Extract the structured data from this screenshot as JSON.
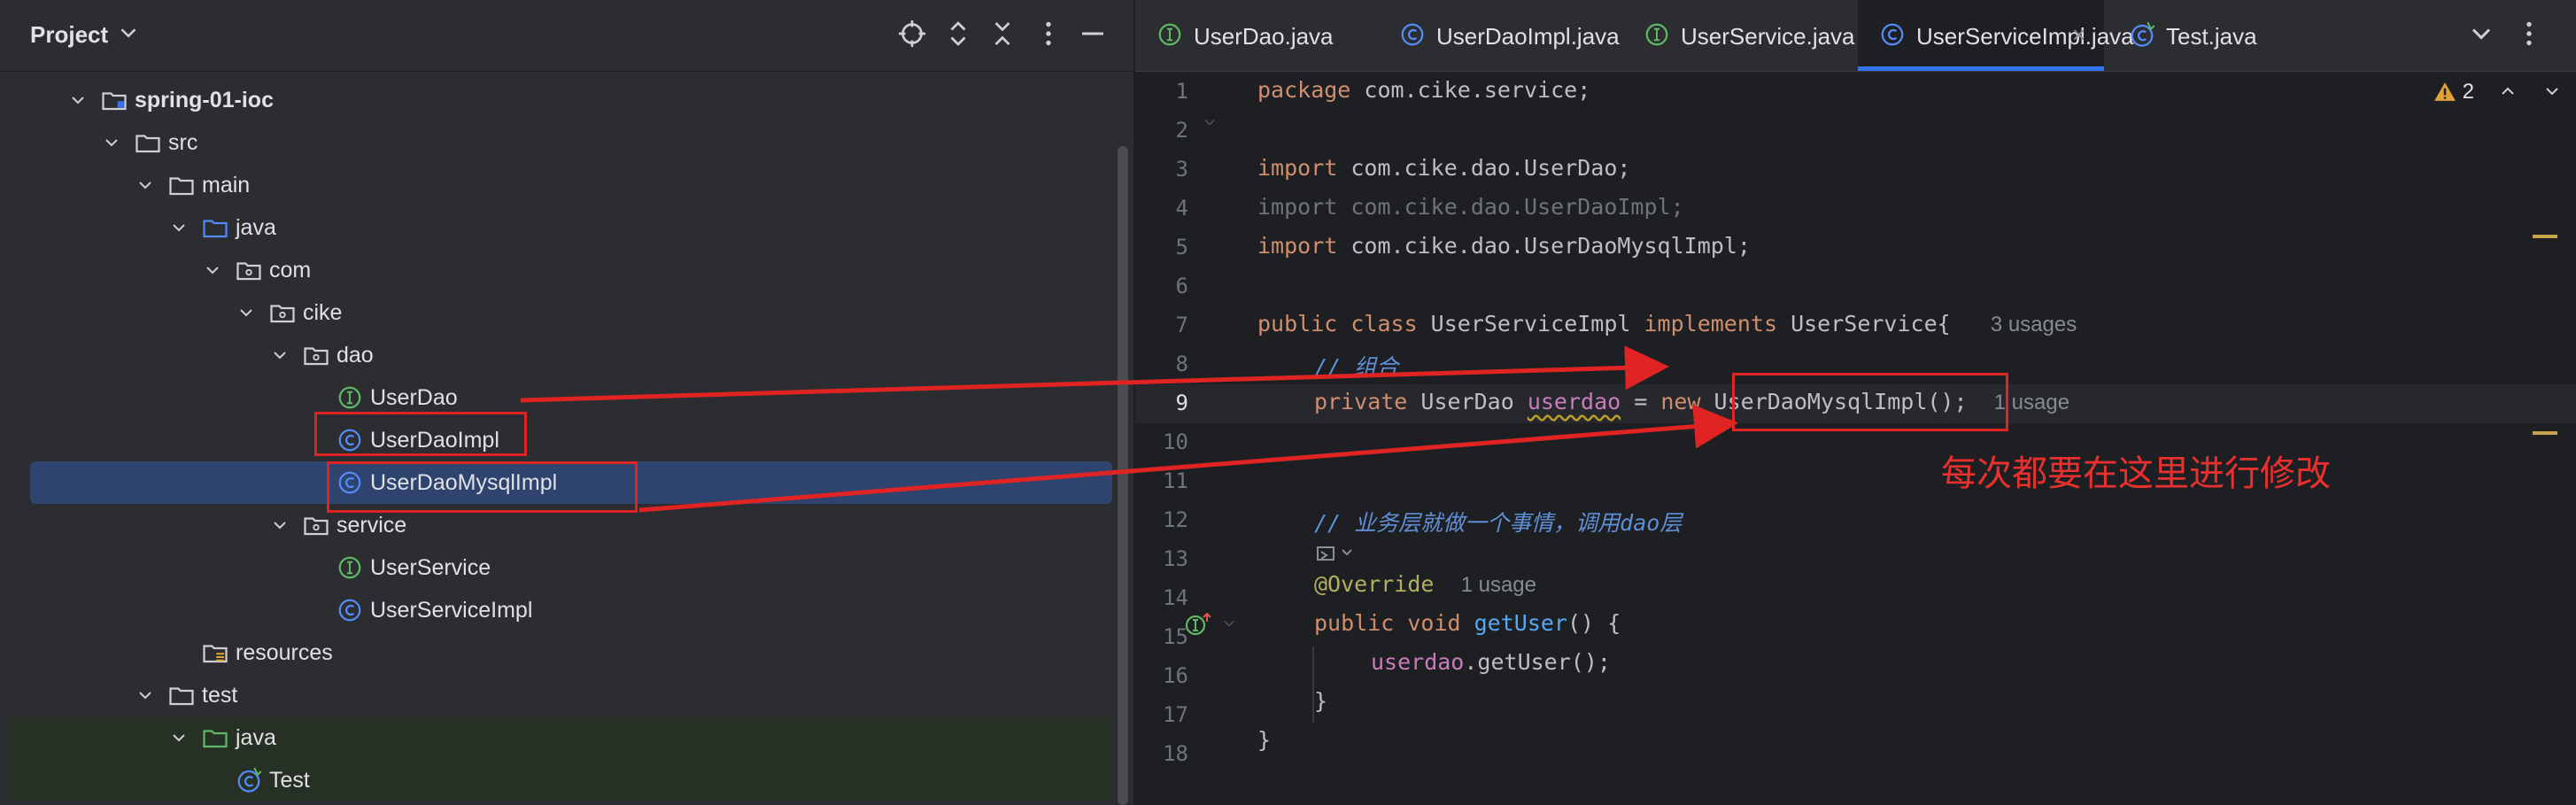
{
  "project_panel": {
    "title": "Project",
    "tree": [
      {
        "label": "spring-01-ioc",
        "icon": "module-folder-icon",
        "depth": 0,
        "expanded": true,
        "bold": true
      },
      {
        "label": "src",
        "icon": "folder-icon",
        "depth": 1,
        "expanded": true
      },
      {
        "label": "main",
        "icon": "folder-icon",
        "depth": 2,
        "expanded": true
      },
      {
        "label": "java",
        "icon": "source-folder-icon",
        "depth": 3,
        "expanded": true
      },
      {
        "label": "com",
        "icon": "package-icon",
        "depth": 4,
        "expanded": true
      },
      {
        "label": "cike",
        "icon": "package-icon",
        "depth": 5,
        "expanded": true
      },
      {
        "label": "dao",
        "icon": "package-icon",
        "depth": 6,
        "expanded": true
      },
      {
        "label": "UserDao",
        "icon": "interface-icon",
        "depth": 7
      },
      {
        "label": "UserDaoImpl",
        "icon": "class-icon",
        "depth": 7
      },
      {
        "label": "UserDaoMysqlImpl",
        "icon": "class-icon",
        "depth": 7,
        "selected": true
      },
      {
        "label": "service",
        "icon": "package-icon",
        "depth": 6,
        "expanded": true
      },
      {
        "label": "UserService",
        "icon": "interface-icon",
        "depth": 7
      },
      {
        "label": "UserServiceImpl",
        "icon": "class-icon",
        "depth": 7
      },
      {
        "label": "resources",
        "icon": "resources-folder-icon",
        "depth": 3
      },
      {
        "label": "test",
        "icon": "folder-icon",
        "depth": 2,
        "expanded": true
      },
      {
        "label": "java",
        "icon": "test-folder-icon",
        "depth": 3,
        "expanded": true,
        "test": true
      },
      {
        "label": "Test",
        "icon": "test-class-icon",
        "depth": 4,
        "test": true
      }
    ]
  },
  "tabs": [
    {
      "label": "UserDao.java",
      "icon": "interface-icon"
    },
    {
      "label": "UserDaoImpl.java",
      "icon": "class-icon"
    },
    {
      "label": "UserService.java",
      "icon": "interface-icon"
    },
    {
      "label": "UserServiceImpl.java",
      "icon": "class-icon",
      "active": true,
      "close": "×"
    },
    {
      "label": "Test.java",
      "icon": "test-class-icon"
    }
  ],
  "editor": {
    "warning_count": "2",
    "line_numbers": [
      "1",
      "2",
      "3",
      "4",
      "5",
      "6",
      "7",
      "8",
      "9",
      "10",
      "11",
      "12",
      "13",
      "14",
      "15",
      "16",
      "17",
      "18"
    ],
    "lines": {
      "l1_kw": "package",
      "l1_rest": " com.cike.service;",
      "l3_kw": "import",
      "l3_rest": " com.cike.dao.UserDao;",
      "l4": "import com.cike.dao.UserDaoImpl;",
      "l5_kw": "import",
      "l5_rest": " com.cike.dao.UserDaoMysqlImpl;",
      "l7_kw1": "public class",
      "l7_name": " UserServiceImpl ",
      "l7_kw2": "implements",
      "l7_rest": " UserService{",
      "l7_hint": "3 usages",
      "l8": "// 组合",
      "l9_kw1": "private",
      "l9_type": " UserDao ",
      "l9_field": "userdao",
      "l9_eq": " = ",
      "l9_kw2": "new",
      "l9_rest": " UserDaoMysqlImpl();",
      "l9_hint": "1 usage",
      "l12": "// 业务层就做一个事情，调用dao层",
      "l13_ann": "@Override",
      "l13_hint": "1 usage",
      "l14_kw": "public void",
      "l14_fn": " getUser",
      "l14_rest": "() {",
      "l15_field": "userdao",
      "l15_rest": ".getUser();",
      "l16": "}",
      "l17": "}"
    }
  },
  "annotation": {
    "text": "每次都要在这里进行修改",
    "color": "#e8312f"
  }
}
